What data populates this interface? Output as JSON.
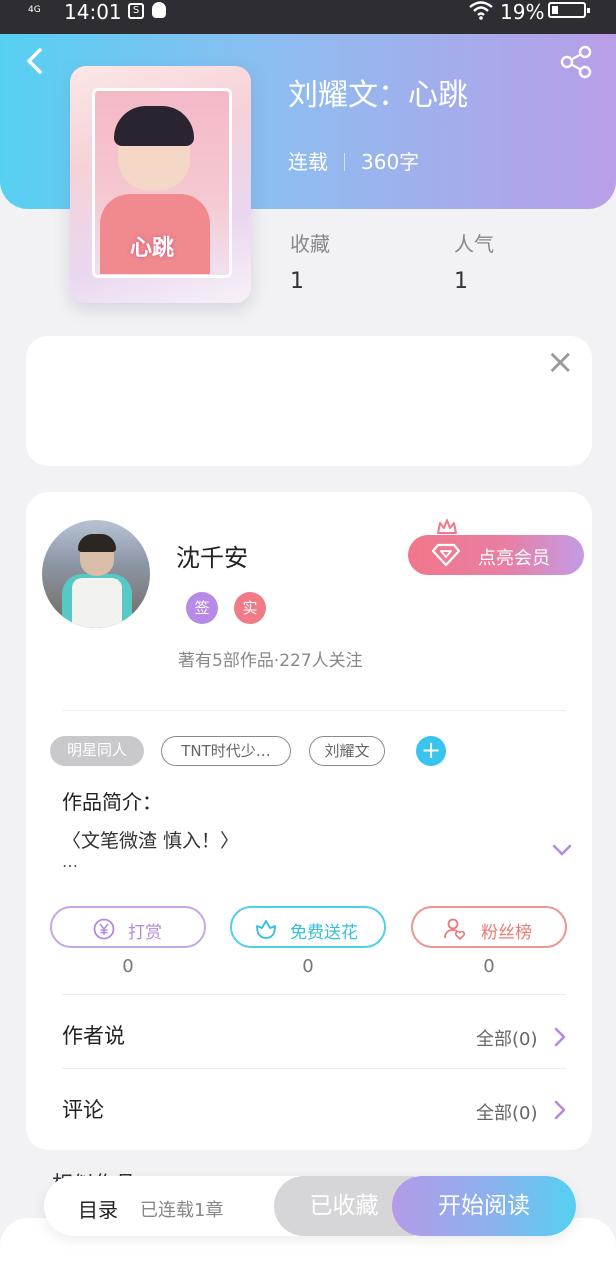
{
  "status_bar": {
    "network": "4G",
    "time": "14:01",
    "battery": "19%"
  },
  "book": {
    "title": "刘耀文：心跳",
    "status": "连载",
    "word_count": "360字",
    "cover_text": "心跳",
    "stats": [
      {
        "label": "收藏",
        "value": "1"
      },
      {
        "label": "人气",
        "value": "1"
      }
    ]
  },
  "ad": {
    "close_symbol": "×"
  },
  "author": {
    "name": "沈千安",
    "badges": [
      "签",
      "实"
    ],
    "stats_text": "著有5部作品·227人关注",
    "vip_button": "点亮会员"
  },
  "tags": [
    "明星同人",
    "TNT时代少…",
    "刘耀文"
  ],
  "tag_add": "+",
  "intro": {
    "title": "作品简介：",
    "text": "〈文笔微渣 慎入！〉",
    "more": "…"
  },
  "actions": [
    {
      "label": "打赏",
      "count": "0"
    },
    {
      "label": "免费送花",
      "count": "0"
    },
    {
      "label": "粉丝榜",
      "count": "0"
    }
  ],
  "rows": [
    {
      "label": "作者说",
      "right": "全部(0)"
    },
    {
      "label": "评论",
      "right": "全部(0)"
    }
  ],
  "related_peek": "相似作品",
  "dock": {
    "toc": "目录",
    "chapters": "已连载1章",
    "collected": "已收藏",
    "read": "开始阅读"
  },
  "colors": {
    "header_gradient": [
      "#56d0f2",
      "#b99ee8"
    ],
    "vip_gradient": [
      "#f2778a",
      "#c39ce6"
    ],
    "read_gradient": [
      "#b49ae8",
      "#55d0f0"
    ],
    "tip": "#b48ae0",
    "flower": "#34bedc",
    "fans": "#ea7a75"
  }
}
